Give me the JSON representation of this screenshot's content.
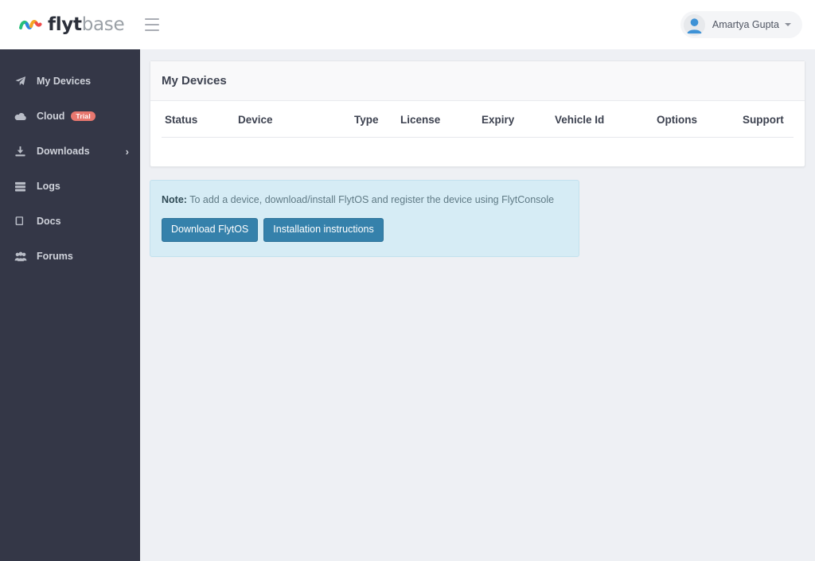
{
  "header": {
    "logo_text_bold": "flyt",
    "logo_text_light": "base",
    "menu_icon": "hamburger-icon",
    "user": {
      "name": "Amartya Gupta",
      "avatar_icon": "user-avatar-icon",
      "caret_icon": "chevron-down-icon"
    }
  },
  "sidebar": {
    "items": [
      {
        "label": "My Devices",
        "icon": "paper-plane-icon",
        "badge": null,
        "chevron": null
      },
      {
        "label": "Cloud",
        "icon": "cloud-icon",
        "badge": "Trial",
        "chevron": null
      },
      {
        "label": "Downloads",
        "icon": "download-icon",
        "badge": null,
        "chevron": "›"
      },
      {
        "label": "Logs",
        "icon": "server-icon",
        "badge": null,
        "chevron": null
      },
      {
        "label": "Docs",
        "icon": "book-icon",
        "badge": null,
        "chevron": null
      },
      {
        "label": "Forums",
        "icon": "users-icon",
        "badge": null,
        "chevron": null
      }
    ]
  },
  "main": {
    "card_title": "My Devices",
    "table": {
      "columns": [
        "Status",
        "Device",
        "Type",
        "License",
        "Expiry",
        "Vehicle Id",
        "Options",
        "Support"
      ],
      "rows": []
    },
    "note": {
      "label": "Note:",
      "text": " To add a device, download/install FlytOS and register the device using FlytConsole",
      "buttons": [
        {
          "label": "Download FlytOS"
        },
        {
          "label": "Installation instructions"
        }
      ]
    }
  },
  "colors": {
    "sidebar_bg": "#343747",
    "page_bg": "#eef0f4",
    "accent_button": "#3581ab",
    "note_bg": "#d6ecf5",
    "badge_trial": "#e8776f"
  }
}
